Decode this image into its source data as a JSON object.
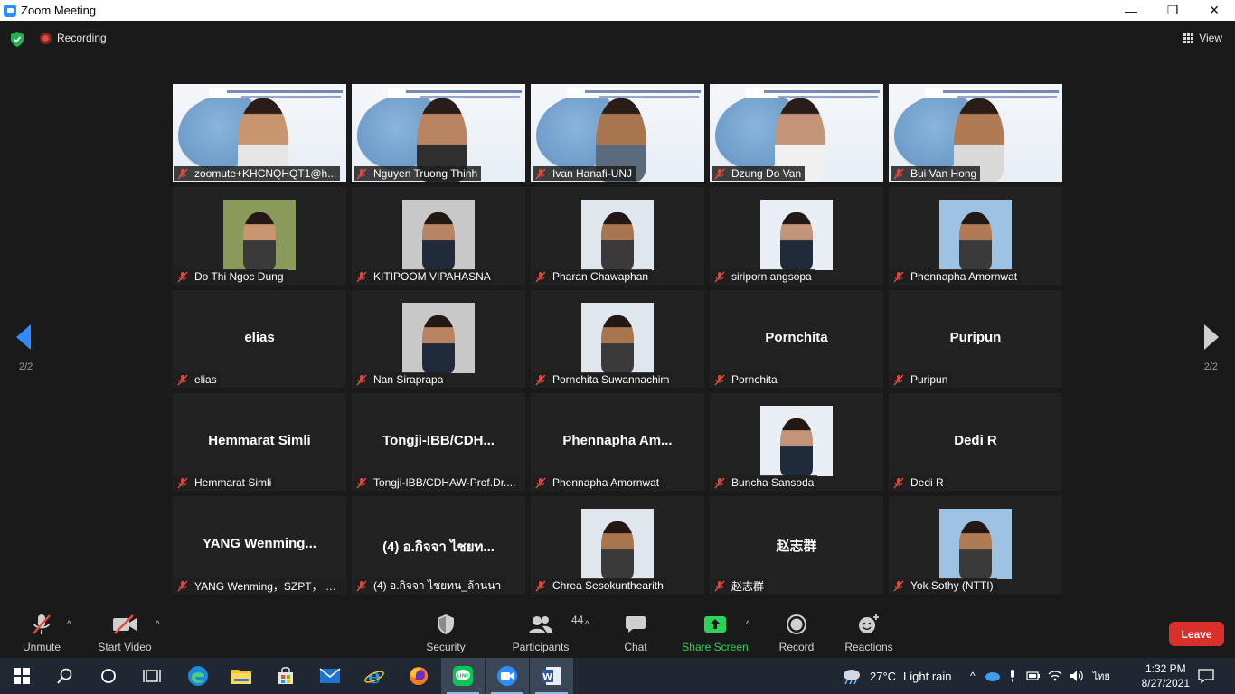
{
  "window": {
    "title": "Zoom Meeting",
    "minimize": "—",
    "maximize": "❐",
    "close": "✕"
  },
  "topbar": {
    "recording_label": "Recording",
    "view_label": "View"
  },
  "pagination": {
    "left_page": "2/2",
    "right_page": "2/2"
  },
  "tiles": [
    {
      "kind": "video",
      "label": "zoomute+KHCNQHQT1@h..."
    },
    {
      "kind": "video",
      "label": "Nguyen Truong Thinh"
    },
    {
      "kind": "video",
      "label": "Ivan Hanafi-UNJ"
    },
    {
      "kind": "video",
      "label": "Dzung Do Van"
    },
    {
      "kind": "video",
      "label": "Bui Van Hong"
    },
    {
      "kind": "photo",
      "label": "Do Thi Ngoc Dung"
    },
    {
      "kind": "photo",
      "label": "KITIPOOM VIPAHASNA"
    },
    {
      "kind": "photo",
      "label": "Pharan Chawaphan"
    },
    {
      "kind": "photo",
      "label": "siriporn angsopa"
    },
    {
      "kind": "photo",
      "label": "Phennapha Amornwat"
    },
    {
      "kind": "name",
      "center": "elias",
      "label": "elias"
    },
    {
      "kind": "photo",
      "label": "Nan Siraprapa"
    },
    {
      "kind": "photo",
      "label": "Pornchita Suwannachim"
    },
    {
      "kind": "name",
      "center": "Pornchita",
      "label": "Pornchita"
    },
    {
      "kind": "name",
      "center": "Puripun",
      "label": "Puripun"
    },
    {
      "kind": "name",
      "center": "Hemmarat Simli",
      "label": "Hemmarat Simli"
    },
    {
      "kind": "name",
      "center": "Tongji-IBB/CDH...",
      "label": "Tongji-IBB/CDHAW-Prof.Dr...."
    },
    {
      "kind": "name",
      "center": "Phennapha  Am...",
      "label": "Phennapha Amornwat"
    },
    {
      "kind": "photo",
      "label": "Buncha Sansoda"
    },
    {
      "kind": "name",
      "center": "Dedi R",
      "label": "Dedi R"
    },
    {
      "kind": "name",
      "center": "YANG  Wenming...",
      "label": "YANG Wenming，SZPT， Ch..."
    },
    {
      "kind": "name",
      "center": "(4) อ.กิจจา  ไชยท...",
      "label": "(4) อ.กิจจา  ไชยทน_ล้านนา"
    },
    {
      "kind": "photo",
      "label": "Chrea Sesokunthearith"
    },
    {
      "kind": "name",
      "center": "赵志群",
      "label": "赵志群"
    },
    {
      "kind": "photo",
      "label": "Yok Sothy (NTTI)"
    }
  ],
  "toolbar": {
    "unmute": "Unmute",
    "start_video": "Start Video",
    "security": "Security",
    "participants": "Participants",
    "participants_count": "44",
    "chat": "Chat",
    "share_screen": "Share Screen",
    "record": "Record",
    "reactions": "Reactions",
    "leave": "Leave",
    "share_color": "#2bd35a",
    "leave_color": "#d9302c"
  },
  "taskbar": {
    "weather_temp": "27°C",
    "weather_desc": "Light rain",
    "language": "ไทย",
    "time": "1:32 PM",
    "date": "8/27/2021"
  }
}
